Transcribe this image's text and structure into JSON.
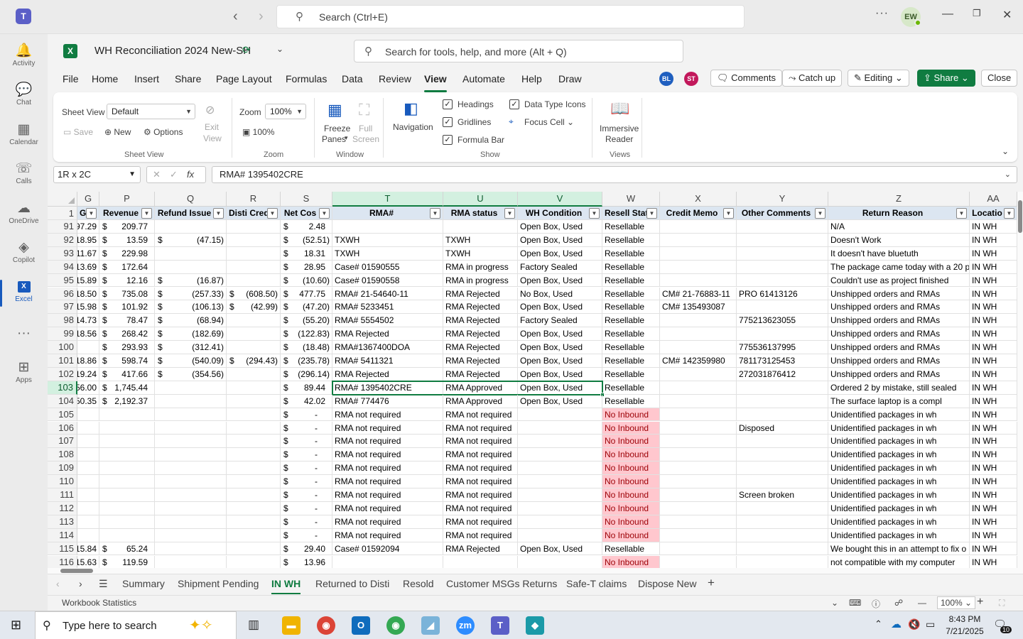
{
  "teams": {
    "logo_text": "T",
    "back_icon": "arrow-left-icon",
    "forward_icon": "arrow-right-icon",
    "search_placeholder": "Search (Ctrl+E)",
    "more_label": "···",
    "user_initials": "EW",
    "rail": [
      {
        "label": "Activity",
        "icon": "bell-icon"
      },
      {
        "label": "Chat",
        "icon": "chat-icon"
      },
      {
        "label": "Calendar",
        "icon": "calendar-icon"
      },
      {
        "label": "Calls",
        "icon": "phone-icon"
      },
      {
        "label": "OneDrive",
        "icon": "cloud-icon"
      },
      {
        "label": "Copilot",
        "icon": "copilot-icon"
      },
      {
        "label": "Excel",
        "icon": "excel-icon"
      },
      {
        "label": "···",
        "icon": "more-icon"
      },
      {
        "label": "Apps",
        "icon": "plus-icon"
      }
    ]
  },
  "excel": {
    "logo_text": "X",
    "doc_title": "WH Reconciliation 2024 New-SH",
    "tools_search": "Search for tools, help, and more (Alt + Q)",
    "menu": [
      "File",
      "Home",
      "Insert",
      "Share",
      "Page Layout",
      "Formulas",
      "Data",
      "Review",
      "View",
      "Automate",
      "Help",
      "Draw"
    ],
    "active_menu": "View",
    "presence": [
      {
        "initials": "BL",
        "color": "#1f5fbf"
      },
      {
        "initials": "ST",
        "color": "#c2185b"
      }
    ],
    "buttons": {
      "comments": "Comments",
      "catchup": "Catch up",
      "editing": "Editing",
      "share": "Share",
      "close": "Close"
    },
    "ribbon": {
      "sheet_view_label": "Sheet View",
      "sheet_view_value": "Default",
      "save": "Save",
      "new": "New",
      "options": "Options",
      "exit_view": [
        "Exit",
        "View"
      ],
      "group_sheet_view": "Sheet View",
      "zoom_label": "Zoom",
      "zoom_value": "100%",
      "zoom_100": "100%",
      "group_zoom": "Zoom",
      "freeze": [
        "Freeze",
        "Panes"
      ],
      "full_screen": [
        "Full",
        "Screen"
      ],
      "group_window": "Window",
      "navigation": "Navigation",
      "headings": "Headings",
      "gridlines": "Gridlines",
      "formula_bar": "Formula Bar",
      "data_type_icons": "Data Type Icons",
      "focus_cell": "Focus Cell",
      "group_show": "Show",
      "immersive": [
        "Immersive",
        "Reader"
      ],
      "group_views": "Views"
    },
    "name_box": "1R x 2C",
    "formula": "RMA# 1395402CRE",
    "fx_label": "fx",
    "columns": [
      "G",
      "P",
      "Q",
      "R",
      "S",
      "T",
      "U",
      "V",
      "W",
      "X",
      "Y",
      "Z",
      "AA"
    ],
    "header_row": {
      "num": "1",
      "cells": [
        "G",
        "Revenue",
        "Refund Issue",
        "Disti Cred",
        "Net Cos",
        "RMA#",
        "RMA status",
        "WH Condition",
        "Resell Stat",
        "Credit Memo",
        "Other Comments",
        "Return Reason",
        "Locatio"
      ]
    },
    "rows": [
      {
        "n": "91",
        "g": "97.29",
        "p": "209.77",
        "q": "",
        "r": "",
        "s": "2.48",
        "t": "",
        "u": "",
        "v": "Open Box, Used",
        "w": "Resellable",
        "x": "",
        "y": "",
        "z": "N/A",
        "aa": "IN WH"
      },
      {
        "n": "92",
        "g": "18.95",
        "p": "13.59",
        "q": "(47.15)",
        "r": "",
        "s": "(52.51)",
        "t": "TXWH",
        "u": "TXWH",
        "v": "Open Box, Used",
        "w": "Resellable",
        "x": "",
        "y": "",
        "z": "Doesn't Work",
        "aa": "IN WH"
      },
      {
        "n": "93",
        "g": "11.67",
        "p": "229.98",
        "q": "",
        "r": "",
        "s": "18.31",
        "t": "TXWH",
        "u": "TXWH",
        "v": "Open Box, Used",
        "w": "Resellable",
        "x": "",
        "y": "",
        "z": "It doesn't have bluetuth",
        "aa": "IN WH"
      },
      {
        "n": "94",
        "g": "13.69",
        "p": "172.64",
        "q": "",
        "r": "",
        "s": "28.95",
        "t": "Case# 01590555",
        "u": "RMA in progress",
        "v": "Factory Sealed",
        "w": "Resellable",
        "x": "",
        "y": "",
        "z": "The package came today with a 20 pa",
        "aa": "IN WH"
      },
      {
        "n": "95",
        "g": "15.89",
        "p": "12.16",
        "q": "(16.87)",
        "r": "",
        "s": "(10.60)",
        "t": "Case# 01590558",
        "u": "RMA in progress",
        "v": "Open Box, Used",
        "w": "Resellable",
        "x": "",
        "y": "",
        "z": "Couldn't use as project finished",
        "aa": "IN WH"
      },
      {
        "n": "96",
        "g": "18.50",
        "p": "735.08",
        "q": "(257.33)",
        "r": "(608.50)",
        "s": "477.75",
        "t": "RMA# 21-54640-11",
        "u": "RMA Rejected",
        "v": "No Box, Used",
        "w": "Resellable",
        "x": "CM# 21-76883-11",
        "y": "PRO 61413126",
        "z": "Unshipped orders and RMAs",
        "aa": "IN WH"
      },
      {
        "n": "97",
        "g": "15.98",
        "p": "101.92",
        "q": "(106.13)",
        "r": "(42.99)",
        "s": "(47.20)",
        "t": "RMA# 5233451",
        "u": "RMA Rejected",
        "v": "Open Box, Used",
        "w": "Resellable",
        "x": "CM# 135493087",
        "y": "",
        "z": "Unshipped orders and RMAs",
        "aa": "IN WH"
      },
      {
        "n": "98",
        "g": "14.73",
        "p": "78.47",
        "q": "(68.94)",
        "r": "",
        "s": "(55.20)",
        "t": "RMA# 5554502",
        "u": "RMA Rejected",
        "v": "Factory Sealed",
        "w": "Resellable",
        "x": "",
        "y": "775213623055",
        "z": "Unshipped orders and RMAs",
        "aa": "IN WH"
      },
      {
        "n": "99",
        "g": "18.56",
        "p": "268.42",
        "q": "(182.69)",
        "r": "",
        "s": "(122.83)",
        "t": "RMA Rejected",
        "u": "RMA Rejected",
        "v": "Open Box, Used",
        "w": "Resellable",
        "x": "",
        "y": "",
        "z": "Unshipped orders and RMAs",
        "aa": "IN WH"
      },
      {
        "n": "100",
        "g": "",
        "p": "293.93",
        "q": "(312.41)",
        "r": "",
        "s": "(18.48)",
        "t": "RMA#1367400DOA",
        "u": "RMA Rejected",
        "v": "Open Box, Used",
        "w": "Resellable",
        "x": "",
        "y": "775536137995",
        "z": "Unshipped orders and RMAs",
        "aa": "IN WH"
      },
      {
        "n": "101",
        "g": "18.86",
        "p": "598.74",
        "q": "(540.09)",
        "r": "(294.43)",
        "s": "(235.78)",
        "t": "RMA# 5411321",
        "u": "RMA Rejected",
        "v": "Open Box, Used",
        "w": "Resellable",
        "x": "CM# 142359980",
        "y": "781173125453",
        "z": "Unshipped orders and RMAs",
        "aa": "IN WH"
      },
      {
        "n": "102",
        "g": "19.24",
        "p": "417.66",
        "q": "(354.56)",
        "r": "",
        "s": "(296.14)",
        "t": "RMA Rejected",
        "u": "RMA Rejected",
        "v": "Open Box, Used",
        "w": "Resellable",
        "x": "",
        "y": "272031876412",
        "z": "Unshipped orders and RMAs",
        "aa": "IN WH"
      },
      {
        "n": "103",
        "g": "56.00",
        "p": "1,745.44",
        "q": "",
        "r": "",
        "s": "89.44",
        "t": "RMA# 1395402CRE",
        "u": "RMA Approved",
        "v": "Open Box, Used",
        "w": "Resellable",
        "x": "",
        "y": "",
        "z": "Ordered 2 by mistake, still sealed",
        "aa": "IN WH"
      },
      {
        "n": "104",
        "g": "50.35",
        "p": "2,192.37",
        "q": "",
        "r": "",
        "s": "42.02",
        "t": "RMA# 774476",
        "u": "RMA Approved",
        "v": "Open Box, Used",
        "w": "Resellable",
        "x": "",
        "y": "",
        "z": "The surface laptop is a compl",
        "aa": "IN WH"
      },
      {
        "n": "105",
        "g": "",
        "p": "",
        "q": "",
        "r": "",
        "s": "-",
        "t": "RMA not required",
        "u": "RMA not required",
        "v": "",
        "w": "No Inbound",
        "x": "",
        "y": "",
        "z": "Unidentified packages in wh",
        "aa": "IN WH"
      },
      {
        "n": "106",
        "g": "",
        "p": "",
        "q": "",
        "r": "",
        "s": "-",
        "t": "RMA not required",
        "u": "RMA not required",
        "v": "",
        "w": "No Inbound",
        "x": "",
        "y": "Disposed",
        "z": "Unidentified packages in wh",
        "aa": "IN WH"
      },
      {
        "n": "107",
        "g": "",
        "p": "",
        "q": "",
        "r": "",
        "s": "-",
        "t": "RMA not required",
        "u": "RMA not required",
        "v": "",
        "w": "No Inbound",
        "x": "",
        "y": "",
        "z": "Unidentified packages in wh",
        "aa": "IN WH"
      },
      {
        "n": "108",
        "g": "",
        "p": "",
        "q": "",
        "r": "",
        "s": "-",
        "t": "RMA not required",
        "u": "RMA not required",
        "v": "",
        "w": "No Inbound",
        "x": "",
        "y": "",
        "z": "Unidentified packages in wh",
        "aa": "IN WH"
      },
      {
        "n": "109",
        "g": "",
        "p": "",
        "q": "",
        "r": "",
        "s": "-",
        "t": "RMA not required",
        "u": "RMA not required",
        "v": "",
        "w": "No Inbound",
        "x": "",
        "y": "",
        "z": "Unidentified packages in wh",
        "aa": "IN WH"
      },
      {
        "n": "110",
        "g": "",
        "p": "",
        "q": "",
        "r": "",
        "s": "-",
        "t": "RMA not required",
        "u": "RMA not required",
        "v": "",
        "w": "No Inbound",
        "x": "",
        "y": "",
        "z": "Unidentified packages in wh",
        "aa": "IN WH"
      },
      {
        "n": "111",
        "g": "",
        "p": "",
        "q": "",
        "r": "",
        "s": "-",
        "t": "RMA not required",
        "u": "RMA not required",
        "v": "",
        "w": "No Inbound",
        "x": "",
        "y": "Screen broken",
        "z": "Unidentified packages in wh",
        "aa": "IN WH"
      },
      {
        "n": "112",
        "g": "",
        "p": "",
        "q": "",
        "r": "",
        "s": "-",
        "t": "RMA not required",
        "u": "RMA not required",
        "v": "",
        "w": "No Inbound",
        "x": "",
        "y": "",
        "z": "Unidentified packages in wh",
        "aa": "IN WH"
      },
      {
        "n": "113",
        "g": "",
        "p": "",
        "q": "",
        "r": "",
        "s": "-",
        "t": "RMA not required",
        "u": "RMA not required",
        "v": "",
        "w": "No Inbound",
        "x": "",
        "y": "",
        "z": "Unidentified packages in wh",
        "aa": "IN WH"
      },
      {
        "n": "114",
        "g": "",
        "p": "",
        "q": "",
        "r": "",
        "s": "-",
        "t": "RMA not required",
        "u": "RMA not required",
        "v": "",
        "w": "No Inbound",
        "x": "",
        "y": "",
        "z": "Unidentified packages in wh",
        "aa": "IN WH"
      },
      {
        "n": "115",
        "g": "15.84",
        "p": "65.24",
        "q": "",
        "r": "",
        "s": "29.40",
        "t": "Case# 01592094",
        "u": "RMA Rejected",
        "v": "Open Box, Used",
        "w": "Resellable",
        "x": "",
        "y": "",
        "z": "We bought this in an attempt to fix o",
        "aa": "IN WH"
      },
      {
        "n": "116",
        "g": "15.63",
        "p": "119.59",
        "q": "",
        "r": "",
        "s": "13.96",
        "t": "",
        "u": "",
        "v": "",
        "w": "No Inbound",
        "x": "",
        "y": "",
        "z": "not compatible with my computer",
        "aa": "IN WH"
      }
    ],
    "currency_symbol": "$",
    "sheet_tabs": [
      "Summary",
      "Shipment Pending",
      "IN WH",
      "Returned to Disti",
      "Resold",
      "Customer MSGs Returns",
      "Safe-T claims",
      "Dispose New"
    ],
    "active_tab": "IN WH",
    "add_sheet": "+",
    "status_left": "Workbook Statistics",
    "status_zoom": "100%",
    "colors": {
      "accent": "#107c41",
      "header_fill": "#dce6f1",
      "no_inbound_fill": "#ffc7ce",
      "no_inbound_text": "#9c0006"
    }
  },
  "taskbar": {
    "search_placeholder": "Type here to search",
    "time": "8:43 PM",
    "date": "7/21/2025",
    "notification_count": "10"
  }
}
